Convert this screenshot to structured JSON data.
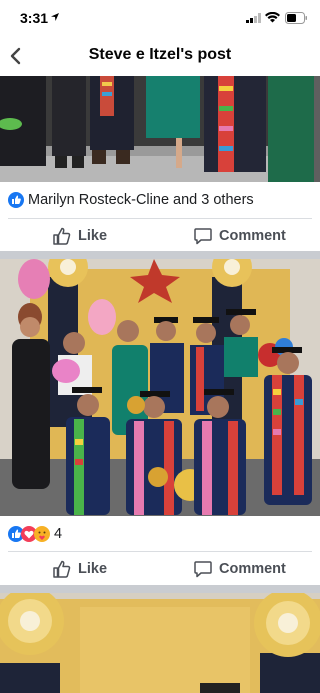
{
  "status": {
    "time": "3:31"
  },
  "nav": {
    "title": "Steve e Itzel's post"
  },
  "post1": {
    "reactions_text": "Marilyn Rosteck-Cline and 3 others",
    "like_label": "Like",
    "comment_label": "Comment"
  },
  "post2": {
    "reactions_text": "4",
    "like_label": "Like",
    "comment_label": "Comment"
  },
  "colors": {
    "facebook_blue": "#1877f2",
    "love_red": "#f33e58",
    "care_yellow": "#f7b125",
    "divider": "#dadde1",
    "separator": "#c9ccd1"
  },
  "icons": [
    "location-arrow-icon",
    "signal-icon",
    "wifi-icon",
    "battery-icon",
    "back-chevron-icon",
    "like-thumb-icon",
    "comment-bubble-icon",
    "like-reaction-icon",
    "love-reaction-icon",
    "care-reaction-icon"
  ]
}
